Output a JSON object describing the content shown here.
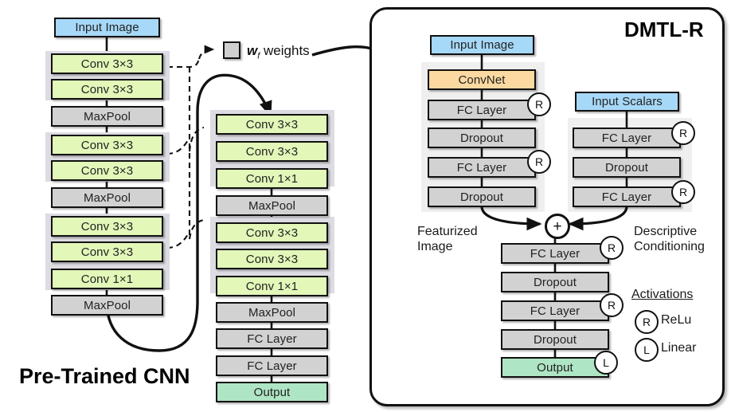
{
  "left_branch": {
    "title": "Pre-Trained CNN",
    "nodes": [
      {
        "label": "Input Image",
        "kind": "blue"
      },
      {
        "label": "Conv 3×3",
        "kind": "green"
      },
      {
        "label": "Conv 3×3",
        "kind": "green"
      },
      {
        "label": "MaxPool",
        "kind": "gray"
      },
      {
        "label": "Conv 3×3",
        "kind": "green"
      },
      {
        "label": "Conv 3×3",
        "kind": "green"
      },
      {
        "label": "MaxPool",
        "kind": "gray"
      },
      {
        "label": "Conv 3×3",
        "kind": "green"
      },
      {
        "label": "Conv 3×3",
        "kind": "green"
      },
      {
        "label": "Conv 1×1",
        "kind": "green"
      },
      {
        "label": "MaxPool",
        "kind": "gray"
      }
    ]
  },
  "middle_branch": {
    "nodes": [
      {
        "label": "Conv 3×3",
        "kind": "green"
      },
      {
        "label": "Conv 3×3",
        "kind": "green"
      },
      {
        "label": "Conv 1×1",
        "kind": "green"
      },
      {
        "label": "MaxPool",
        "kind": "gray"
      },
      {
        "label": "Conv 3×3",
        "kind": "green"
      },
      {
        "label": "Conv 3×3",
        "kind": "green"
      },
      {
        "label": "Conv 1×1",
        "kind": "green"
      },
      {
        "label": "MaxPool",
        "kind": "gray"
      },
      {
        "label": "FC Layer",
        "kind": "gray"
      },
      {
        "label": "FC Layer",
        "kind": "gray"
      },
      {
        "label": "Output",
        "kind": "mint"
      }
    ]
  },
  "weights": {
    "symbol": "w",
    "subscript": "f",
    "label": "weights"
  },
  "panel": {
    "title": "DMTL-R",
    "image_branch": {
      "caption": "Featurized\nImage",
      "nodes": [
        {
          "label": "Input Image",
          "kind": "blue",
          "act": null
        },
        {
          "label": "ConvNet",
          "kind": "orange",
          "act": null
        },
        {
          "label": "FC Layer",
          "kind": "gray",
          "act": "R"
        },
        {
          "label": "Dropout",
          "kind": "gray",
          "act": null
        },
        {
          "label": "FC Layer",
          "kind": "gray",
          "act": "R"
        },
        {
          "label": "Dropout",
          "kind": "gray",
          "act": null
        }
      ]
    },
    "scalar_branch": {
      "caption": "Descriptive\nConditioning",
      "nodes": [
        {
          "label": "Input Scalars",
          "kind": "blue",
          "act": null
        },
        {
          "label": "FC Layer",
          "kind": "gray",
          "act": "R"
        },
        {
          "label": "Dropout",
          "kind": "gray",
          "act": null
        },
        {
          "label": "FC Layer",
          "kind": "gray",
          "act": "R"
        }
      ]
    },
    "merge_symbol": "+",
    "head_branch": {
      "nodes": [
        {
          "label": "FC Layer",
          "kind": "gray",
          "act": "R"
        },
        {
          "label": "Dropout",
          "kind": "gray",
          "act": null
        },
        {
          "label": "FC Layer",
          "kind": "gray",
          "act": "R"
        },
        {
          "label": "Dropout",
          "kind": "gray",
          "act": null
        },
        {
          "label": "Output",
          "kind": "mint",
          "act": "L"
        }
      ]
    },
    "legend": {
      "title": "Activations",
      "items": [
        {
          "symbol": "R",
          "label": "ReLu"
        },
        {
          "symbol": "L",
          "label": "Linear"
        }
      ]
    }
  },
  "colors": {
    "green": "#e2f7b8",
    "gray": "#d2d2d2",
    "blue": "#a6d8f7",
    "orange": "#fbd9a1",
    "mint": "#aee5c4",
    "group": "#dcdce2",
    "stroke": "#111111"
  }
}
